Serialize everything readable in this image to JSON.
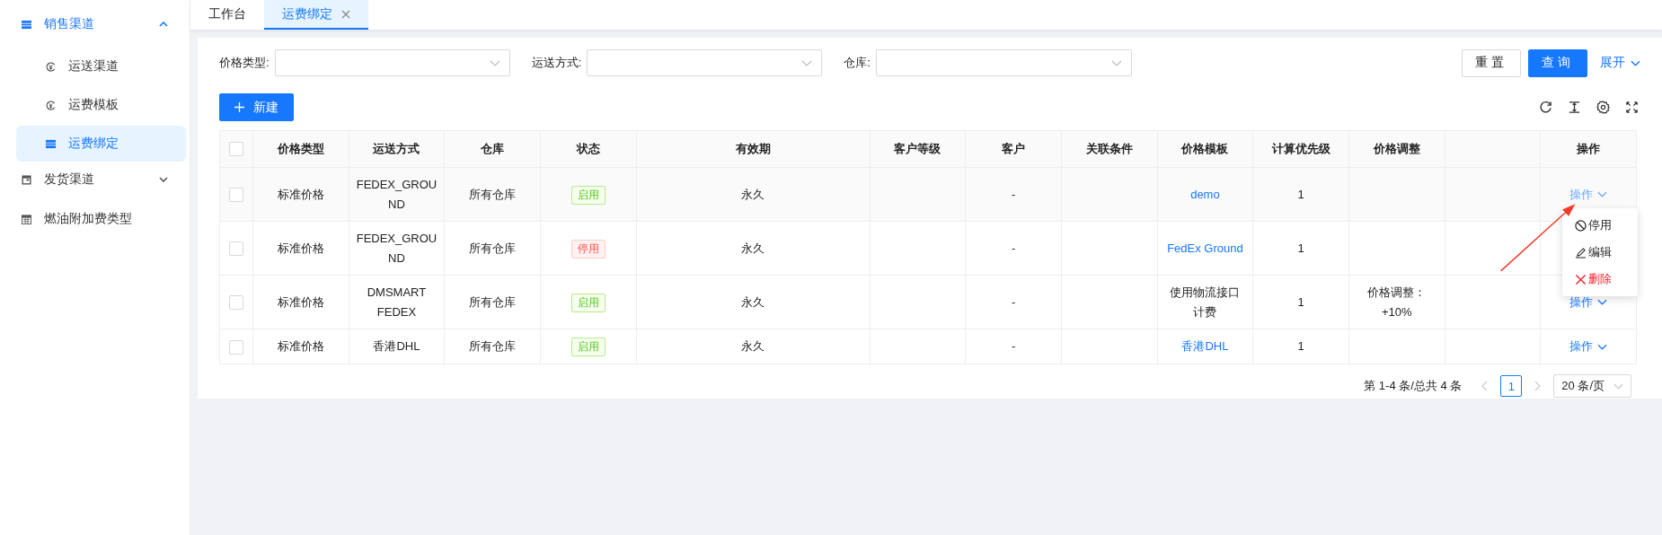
{
  "sidebar": {
    "items": [
      {
        "label": "销售渠道",
        "kind": "list",
        "expanded": true,
        "children": [
          {
            "label": "运送渠道",
            "kind": "coin",
            "selected": false
          },
          {
            "label": "运费模板",
            "kind": "coin",
            "selected": false
          },
          {
            "label": "运费绑定",
            "kind": "list",
            "selected": true
          }
        ]
      },
      {
        "label": "发货渠道",
        "kind": "window",
        "expanded": false
      },
      {
        "label": "燃油附加费类型",
        "kind": "calendar"
      }
    ]
  },
  "tabs": [
    {
      "label": "工作台",
      "selected": false,
      "closable": false
    },
    {
      "label": "运费绑定",
      "selected": true,
      "closable": true
    }
  ],
  "filters": [
    {
      "label": "价格类型:"
    },
    {
      "label": "运送方式:"
    },
    {
      "label": "仓库:"
    }
  ],
  "buttons": {
    "reset": "重置",
    "search": "查询",
    "expand": "展开"
  },
  "new_button": "新建",
  "table": {
    "columns": [
      "价格类型",
      "运送方式",
      "仓库",
      "状态",
      "有效期",
      "客户等级",
      "客户",
      "关联条件",
      "价格模板",
      "计算优先级",
      "价格调整"
    ],
    "action_column": "操作",
    "select_all": {
      "checked": false
    },
    "rows": [
      {
        "hovered": true,
        "checked": false,
        "price_type": "标准价格",
        "shipping": "FEDEX_GROUND",
        "warehouse": "所有仓库",
        "status": {
          "label": "启用",
          "enabled": true
        },
        "validity": "永久",
        "customer": "-",
        "template": {
          "text": "demo",
          "kind": "link"
        },
        "priority": "1",
        "action": "操作"
      },
      {
        "hovered": false,
        "checked": false,
        "price_type": "标准价格",
        "shipping": "FEDEX_GROUND",
        "warehouse": "所有仓库",
        "status": {
          "label": "停用",
          "enabled": false
        },
        "validity": "永久",
        "customer": "-",
        "template": {
          "text": "FedEx Ground",
          "kind": "link"
        },
        "priority": "1"
      },
      {
        "hovered": false,
        "checked": false,
        "price_type": "标准价格",
        "shipping": "DMSMART FEDEX",
        "warehouse": "所有仓库",
        "status": {
          "label": "启用",
          "enabled": true
        },
        "validity": "永久",
        "customer": "-",
        "template": {
          "text": "使用物流接口计费",
          "kind": "text"
        },
        "priority": "1",
        "adjustment": "价格调整：+10%",
        "action": "操作"
      },
      {
        "hovered": false,
        "checked": false,
        "price_type": "标准价格",
        "shipping": "香港DHL",
        "warehouse": "所有仓库",
        "status": {
          "label": "启用",
          "enabled": true
        },
        "validity": "永久",
        "customer": "-",
        "template": {
          "text": "香港DHL",
          "kind": "link"
        },
        "priority": "1",
        "action": "操作"
      }
    ]
  },
  "action_menu": [
    {
      "label": "停用",
      "kind": "disable"
    },
    {
      "label": "编辑",
      "kind": "edit"
    },
    {
      "label": "删除",
      "kind": "delete"
    }
  ],
  "pagination": {
    "summary": "第 1-4 条/总共 4 条",
    "pages": [
      {
        "label": "1",
        "selected": true
      }
    ],
    "page_size": "20 条/页"
  }
}
